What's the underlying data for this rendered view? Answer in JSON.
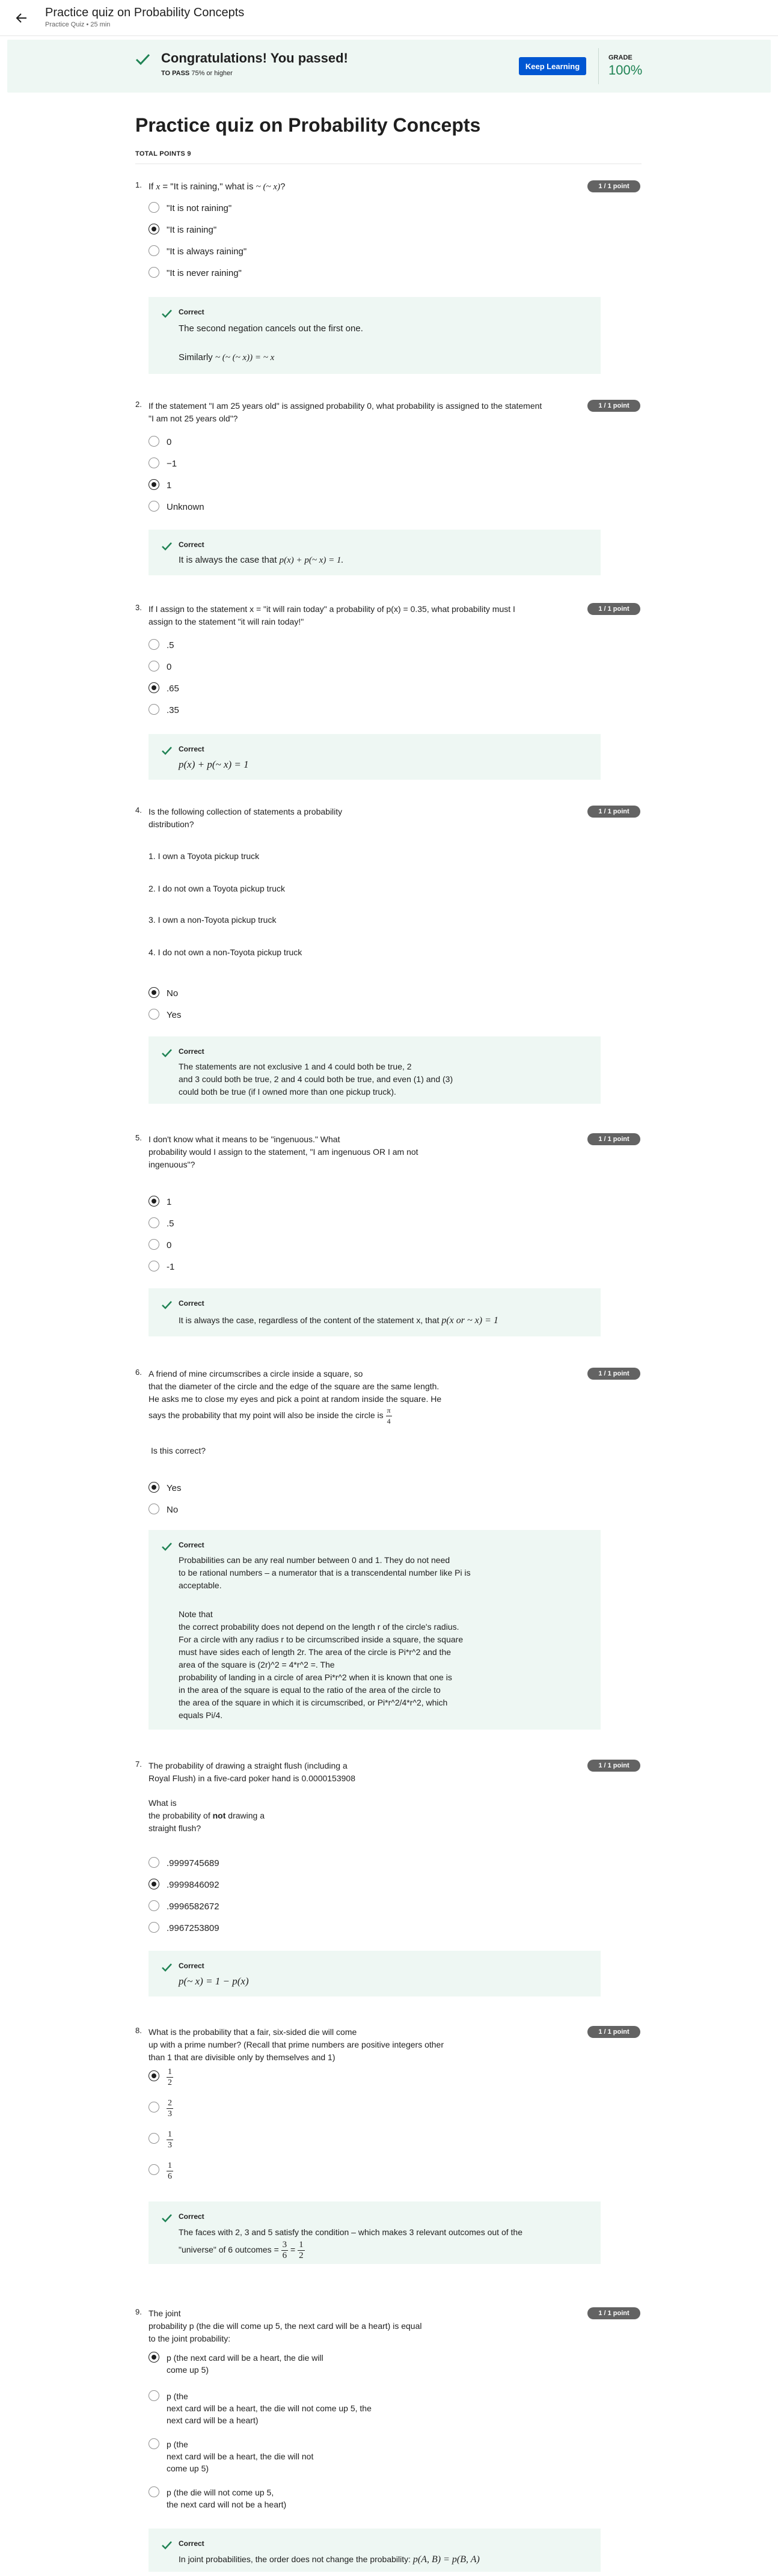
{
  "header": {
    "title": "Practice quiz on Probability Concepts",
    "subtitle": "Practice Quiz • 25 min"
  },
  "banner": {
    "title": "Congratulations! You passed!",
    "to_pass_label": "TO PASS",
    "to_pass_value": "75% or higher",
    "button_label": "Keep Learning",
    "grade_label": "GRADE",
    "grade_value": "100%"
  },
  "quiz": {
    "title": "Practice quiz on Probability Concepts",
    "total_points": "TOTAL POINTS 9"
  },
  "colors": {
    "accent": "#0056d2",
    "success": "#1f8354",
    "banner_bg": "#eef7f3",
    "badge": "#636363"
  },
  "questions": [
    {
      "num": "1.",
      "badge": "1 / 1 point",
      "text_pre": "If",
      "text_var": "x",
      "text_eq": "= \"It is raining,\" what is",
      "text_expr": "~ (~ x)",
      "text_post": "?",
      "options": [
        "\"It is not raining\"",
        "\"It is raining\"",
        "\"It is always raining\"",
        "\"It is never raining\""
      ],
      "selected": 1,
      "fb_title": "Correct",
      "fb_line1": "The second negation cancels out the first one.",
      "fb_line2": "Similarly",
      "fb_line2_math": "~ (~ (~ x)) = ~ x"
    },
    {
      "num": "2.",
      "badge": "1 / 1 point",
      "text_line1": "If the statement \"I am 25 years old\" is assigned probability 0, what probability is assigned to the statement",
      "text_line2": "\"I am not 25 years old\"?",
      "options": [
        "0",
        "−1",
        "1",
        "Unknown"
      ],
      "selected": 2,
      "fb_title": "Correct",
      "fb_line1": "It is always the case that",
      "fb_line1_math": "p(x) + p(~ x) = 1."
    },
    {
      "num": "3.",
      "badge": "1 / 1 point",
      "text_line1": "If I assign to the statement x = \"it will rain today\" a probability of p(x) = 0.35, what probability must I",
      "text_line2": "assign to the statement \"it will rain today!\"",
      "options": [
        ".5",
        "0",
        ".65",
        ".35"
      ],
      "selected": 2,
      "fb_title": "Correct",
      "fb_math": "p(x) + p(~ x) = 1"
    },
    {
      "num": "4.",
      "badge": "1 / 1 point",
      "text_line1": "Is the following collection of statements a probability",
      "text_line2": "distribution?",
      "items": [
        "1. I own a Toyota pickup truck",
        "2. I do not own a Toyota pickup truck",
        "3. I own a non-Toyota pickup truck",
        "4. I do not own a non-Toyota pickup truck"
      ],
      "options": [
        "No",
        "Yes"
      ],
      "selected": 0,
      "fb_title": "Correct",
      "fb_lines": [
        "The statements are not exclusive 1 and 4 could both be true, 2",
        "and 3 could both be true, 2 and 4 could both be true, and even (1) and (3)",
        "could both be true (if I owned more than one pickup truck)."
      ]
    },
    {
      "num": "5.",
      "badge": "1 / 1 point",
      "text_lines": [
        "I don't know what it means to be \"ingenuous.\" What",
        "probability would I assign to the statement, \"I am ingenuous OR I am not",
        "ingenuous\"?"
      ],
      "options": [
        "1",
        ".5",
        "0",
        "-1"
      ],
      "selected": 0,
      "fb_title": "Correct",
      "fb_line1": "It is always the case, regardless of the content of the statement x, that",
      "fb_line1_math": "p(x or ~ x) = 1"
    },
    {
      "num": "6.",
      "badge": "1 / 1 point",
      "text_lines": [
        "A friend of mine circumscribes a circle inside a square, so",
        "that the diameter of the circle and the edge of the square are the same length.",
        "He asks me to close my eyes and pick a point at random inside the square. He",
        "says the probability that my point will also be inside the circle is"
      ],
      "frac_n": "π",
      "frac_d": "4",
      "text_after": "Is this correct?",
      "options": [
        "Yes",
        "No"
      ],
      "selected": 0,
      "fb_title": "Correct",
      "fb_lines1": [
        "Probabilities can be any real number between 0 and 1. They do not need",
        "to be rational numbers – a numerator that is a transcendental number like Pi is",
        "acceptable."
      ],
      "fb_lines2": [
        "Note that",
        "the correct probability does not depend on the length r of the circle's radius.",
        "For a circle with any radius r to be circumscribed inside a square, the square",
        "must have sides each of length 2r. The area of the circle is Pi*r^2 and the",
        "area of the square is (2r)^2 = 4*r^2 =. The",
        "probability of landing in a circle of area Pi*r^2 when it is known that one is",
        "in the area of the square is equal to the ratio of the area of the circle to",
        "the area of the square in which it is circumscribed, or Pi*r^2/4*r^2, which",
        "equals Pi/4."
      ]
    },
    {
      "num": "7.",
      "badge": "1 / 1 point",
      "text_lines": [
        "The probability of drawing a straight flush (including a",
        "Royal Flush) in a five-card poker hand is 0.0000153908"
      ],
      "text_lines2_pre": [
        "What is"
      ],
      "text_lines2_mid_pre": "the probability of",
      "text_lines2_bold": "not",
      "text_lines2_mid_post": "drawing a",
      "text_lines2_post": [
        "straight flush?"
      ],
      "options": [
        ".9999745689",
        ".9999846092",
        ".9996582672",
        ".9967253809"
      ],
      "selected": 1,
      "fb_title": "Correct",
      "fb_math": "p(~ x) = 1 − p(x)"
    },
    {
      "num": "8.",
      "badge": "1 / 1 point",
      "text_lines": [
        "What is the probability that a fair, six-sided die will come",
        "up with a prime number? (Recall that prime numbers are positive integers other",
        "than 1 that are divisible only by themselves and 1)"
      ],
      "options_frac": [
        [
          "1",
          "2"
        ],
        [
          "2",
          "3"
        ],
        [
          "1",
          "3"
        ],
        [
          "1",
          "6"
        ]
      ],
      "selected": 0,
      "fb_title": "Correct",
      "fb_line1": "The faces with 2, 3 and 5 satisfy the condition – which makes 3 relevant outcomes out of the",
      "fb_line2_pre": "\"universe\" of 6 outcomes =",
      "fb_frac1": [
        "3",
        "6"
      ],
      "fb_eq": "=",
      "fb_frac2": [
        "1",
        "2"
      ]
    },
    {
      "num": "9.",
      "badge": "1 / 1 point",
      "text_lines": [
        "The joint",
        "probability p (the die will come up 5, the next card will be a heart) is equal",
        "to the joint probability:"
      ],
      "options_multi": [
        [
          "p (the next card will be a heart, the die will",
          "come up 5)"
        ],
        [
          "p (the",
          "next card will be a heart, the die will not come up 5, the",
          "next card will be a heart)"
        ],
        [
          "p (the",
          "next card will be a heart, the die will not",
          "come up 5)"
        ],
        [
          "p (the die will not come up 5,",
          "the next card will not be a heart)"
        ]
      ],
      "selected": 0,
      "fb_title": "Correct",
      "fb_line1": "In joint probabilities, the order does not change the probability:",
      "fb_line1_math": "p(A, B) = p(B, A)"
    }
  ]
}
